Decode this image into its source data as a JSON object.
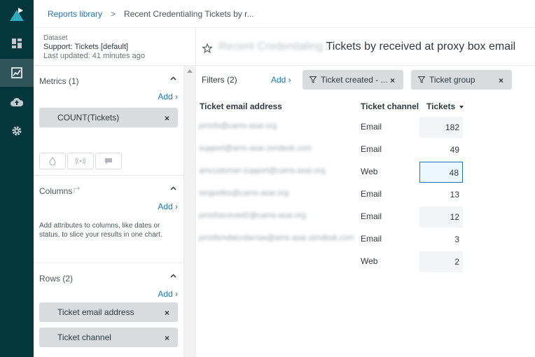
{
  "breadcrumb": {
    "library_label": "Reports library",
    "separator": ">",
    "current_label": "Recent Credentialing Tickets by r..."
  },
  "dataset": {
    "label": "Dataset",
    "name": "Support: Tickets [default]",
    "updated": "Last updated: 41 minutes ago"
  },
  "metrics": {
    "title": "Metrics (1)",
    "add_label": "Add ›",
    "items": [
      {
        "label": "COUNT(Tickets)",
        "remove": "×"
      }
    ]
  },
  "columns": {
    "title": "Columns",
    "add_label": "Add ›",
    "help": "Add attributes to columns, like dates or status, to slice your results in one chart."
  },
  "rows": {
    "title": "Rows (2)",
    "add_label": "Add ›",
    "items": [
      {
        "label": "Ticket email address",
        "remove": "×"
      },
      {
        "label": "Ticket channel",
        "remove": "×"
      }
    ]
  },
  "report": {
    "title_blurred": "Recent Credentialing",
    "title": "Tickets by received at proxy box email"
  },
  "filters": {
    "label": "Filters (2)",
    "add_label": "Add ›",
    "chips": [
      {
        "label": "Ticket created - ...",
        "remove": "×"
      },
      {
        "label": "Ticket group",
        "remove": "×"
      }
    ]
  },
  "table": {
    "headers": {
      "email": "Ticket email address",
      "channel": "Ticket channel",
      "count": "Tickets"
    },
    "rows": [
      {
        "email": "proofs@cams-asar.org",
        "channel": "Email",
        "count": "182"
      },
      {
        "email": "support@ams-asar.zendesk.com",
        "channel": "Email",
        "count": "49"
      },
      {
        "email": "amcustomer.support@cams-asar.org",
        "channel": "Web",
        "count": "48"
      },
      {
        "email": "singoofes@cams-asar.org",
        "channel": "Email",
        "count": "13"
      },
      {
        "email": "proofseceved2@cams-asar.org",
        "channel": "Email",
        "count": "12"
      },
      {
        "email": "proofsmdaicrdarnas@ams-asar.zendesk.com",
        "channel": "Email",
        "count": "3"
      },
      {
        "email": "",
        "channel": "Web",
        "count": "2"
      }
    ]
  },
  "colors": {
    "nav_bg": "#03363d",
    "link": "#1f73b7",
    "pill_bg": "#d8dcde"
  }
}
